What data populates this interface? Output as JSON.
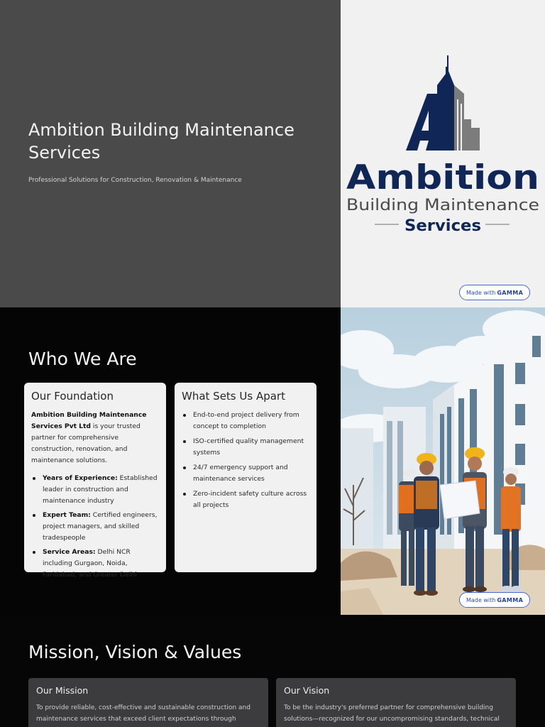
{
  "slide1": {
    "title": "Ambition Building Maintenance Services",
    "subtitle": "Professional Solutions for Construction, Renovation & Maintenance",
    "logo": {
      "wordmark": "Ambition",
      "line2": "Building Maintenance",
      "line3": "Services",
      "colors": {
        "navy": "#0f2656",
        "gray": "#4a4a4a",
        "light_gray": "#7c7c7c"
      }
    },
    "badge": {
      "prefix": "Made with",
      "brand": "GAMMA"
    }
  },
  "slide2": {
    "title": "Who We Are",
    "foundation": {
      "heading": "Our Foundation",
      "intro_bold": "Ambition Building Maintenance Services Pvt Ltd",
      "intro_rest": " is your trusted partner for comprehensive construction, renovation, and maintenance solutions.",
      "items": [
        {
          "label": "Years of Experience:",
          "text": " Established leader in construction and maintenance industry"
        },
        {
          "label": "Expert Team:",
          "text": " Certified engineers, project managers, and skilled tradespeople"
        },
        {
          "label": "Service Areas:",
          "text": " Delhi NCR including Gurgaon, Noida, Faridabad, and Greater Delhi"
        }
      ]
    },
    "apart": {
      "heading": "What Sets Us Apart",
      "items": [
        "End-to-end project delivery from concept to completion",
        "ISO-certified quality management systems",
        "24/7 emergency support and maintenance services",
        "Zero-incident safety culture across all projects"
      ]
    },
    "badge": {
      "prefix": "Made with",
      "brand": "GAMMA"
    }
  },
  "slide3": {
    "title": "Mission, Vision & Values",
    "mission": {
      "heading": "Our Mission",
      "text": "To provide reliable, cost-effective and sustainable construction and maintenance services that exceed client expectations through innovative, integrity, and excellence."
    },
    "vision": {
      "heading": "Our Vision",
      "text": "To be the industry's preferred partner for comprehensive building solutions—recognized for our uncompromising standards, technical leadership, and commitment to safety and the environment."
    }
  }
}
